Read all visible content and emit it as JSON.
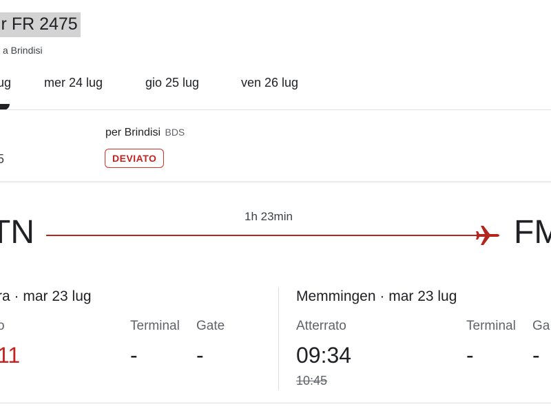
{
  "header": {
    "flight_title": "ir FR 2475",
    "route_subtitle": "a Brindisi"
  },
  "date_tabs": [
    {
      "label": "ug"
    },
    {
      "label": "mer 24 lug"
    },
    {
      "label": "gio 25 lug"
    },
    {
      "label": "ven 26 lug"
    }
  ],
  "summary": {
    "destination_label": "per Brindisi",
    "destination_code": "BDS",
    "status_badge": "DEVIATO",
    "partial_time_fragment": "5",
    "status_color": "#c5221f"
  },
  "route": {
    "origin_code": "TN",
    "destination_code": "FM",
    "duration": "1h 23min",
    "line_color": "#b3261e",
    "icon": "airplane-icon"
  },
  "departure": {
    "place_date": "ra · mar 23 lug",
    "status_label": "o",
    "time": "11",
    "terminal_label": "Terminal",
    "terminal_value": "-",
    "gate_label": "Gate",
    "gate_value": "-"
  },
  "arrival": {
    "place_date": "Memmingen · mar 23 lug",
    "status_label": "Atterrato",
    "time": "09:34",
    "scheduled_time": "10:45",
    "terminal_label": "Terminal",
    "terminal_value": "-",
    "gate_label": "Ga",
    "gate_value": "-"
  }
}
